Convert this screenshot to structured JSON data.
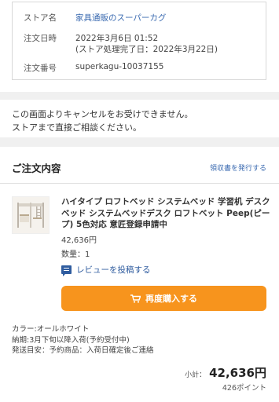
{
  "store_info": {
    "store_name_label": "ストア名",
    "store_name": "家具通販のスーパーカグ",
    "order_date_label": "注文日時",
    "order_date": "2022年3月6日 01:52",
    "processing_done": "(ストア処理完了日：2022年3月22日)",
    "order_number_label": "注文番号",
    "order_number": "superkagu-10037155"
  },
  "notice": {
    "line1": "この画面よりキャンセルをお受けできません。",
    "line2": "ストアまで直接ご相談ください。"
  },
  "order": {
    "title": "ご注文内容",
    "receipt_link": "領収書を発行する",
    "product": {
      "name": "ハイタイプ ロフトベッド システムベッド 学習机 デスクベッド システムベッドデスク ロフトベット Peep(ピープ) 5色対応 意匠登録申請中",
      "price": "42,636円",
      "quantity": "数量：1"
    },
    "review_link": "レビューを投稿する",
    "buy_again_button": "再度購入する",
    "color": "カラー:オールホワイト",
    "delivery": "納期:3月下旬以降入荷(予約受付中)",
    "shipping": "発送目安：予約商品：入荷日確定後ご連絡",
    "subtotal_label": "小計：",
    "subtotal_value": "42,636円",
    "points": "426ポイント"
  },
  "colors": {
    "accent_orange": "#f7941d",
    "link_blue": "#3a6ab0",
    "background": "#f0f0f0"
  }
}
